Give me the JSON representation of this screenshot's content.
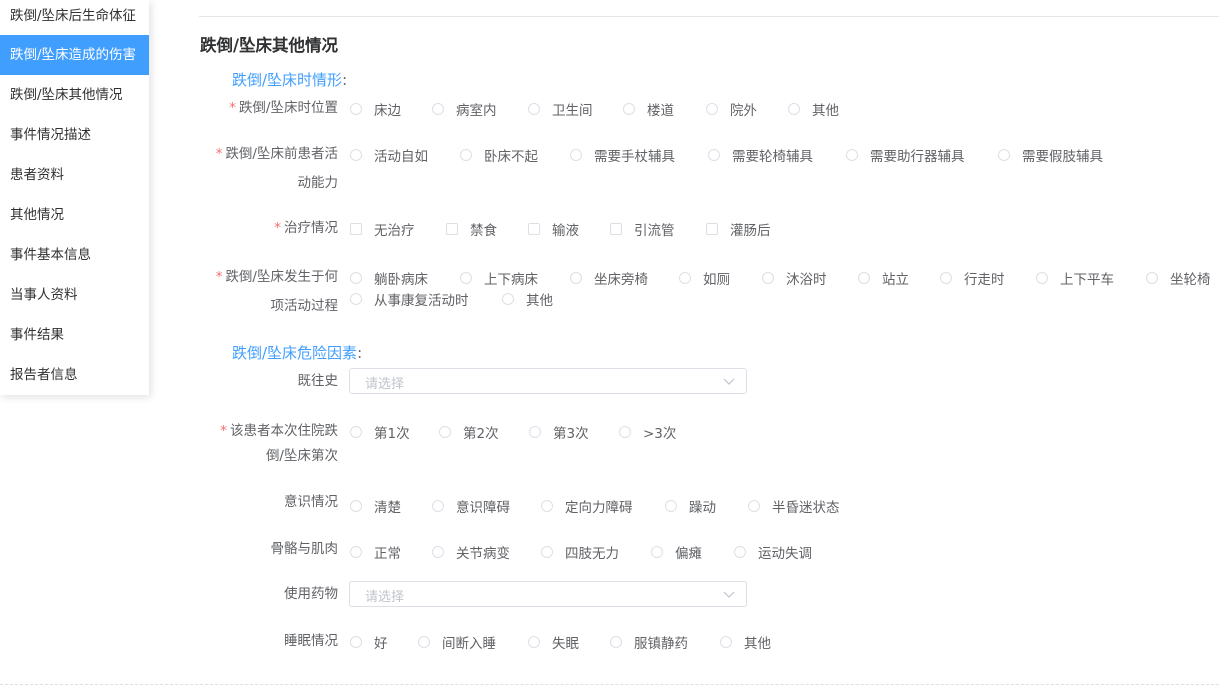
{
  "sidebar": {
    "items": [
      {
        "label": "跌倒/坠床后生命体征",
        "active": false
      },
      {
        "label": "跌倒/坠床造成的伤害",
        "active": true
      },
      {
        "label": "跌倒/坠床其他情况",
        "active": false
      },
      {
        "label": "事件情况描述",
        "active": false
      },
      {
        "label": "患者资料",
        "active": false
      },
      {
        "label": "其他情况",
        "active": false
      },
      {
        "label": "事件基本信息",
        "active": false
      },
      {
        "label": "当事人资料",
        "active": false
      },
      {
        "label": "事件结果",
        "active": false
      },
      {
        "label": "报告者信息",
        "active": false
      }
    ]
  },
  "main": {
    "section_title": "跌倒/坠床其他情况",
    "situation_title": "跌倒/坠床时情形",
    "risk_title": "跌倒/坠床危险因素",
    "colon": ":",
    "required_mark": "*",
    "fields": {
      "location": {
        "label": "跌倒/坠床时位置",
        "options": [
          "床边",
          "病室内",
          "卫生间",
          "楼道",
          "院外",
          "其他"
        ]
      },
      "ability": {
        "label_line1": "跌倒/坠床前患者活",
        "label_line2": "动能力",
        "options": [
          "活动自如",
          "卧床不起",
          "需要手杖辅具",
          "需要轮椅辅具",
          "需要助行器辅具",
          "需要假肢辅具"
        ]
      },
      "treatment": {
        "label": "治疗情况",
        "options": [
          "无治疗",
          "禁食",
          "输液",
          "引流管",
          "灌肠后"
        ]
      },
      "activity": {
        "label_line1": "跌倒/坠床发生于何",
        "label_line2": "项活动过程",
        "options": [
          "躺卧病床",
          "上下病床",
          "坐床旁椅",
          "如厕",
          "沐浴时",
          "站立",
          "行走时",
          "上下平车",
          "坐轮椅",
          "从事康复活动时",
          "其他"
        ]
      },
      "history": {
        "label": "既往史",
        "placeholder": "请选择"
      },
      "count": {
        "label_line1": "该患者本次住院跌",
        "label_line2": "倒/坠床第次",
        "options": [
          "第1次",
          "第2次",
          "第3次",
          ">3次"
        ]
      },
      "consciousness": {
        "label": "意识情况",
        "options": [
          "清楚",
          "意识障碍",
          "定向力障碍",
          "躁动",
          "半昏迷状态"
        ]
      },
      "musculoskeletal": {
        "label": "骨骼与肌肉",
        "options": [
          "正常",
          "关节病变",
          "四肢无力",
          "偏瘫",
          "运动失调"
        ]
      },
      "medication": {
        "label": "使用药物",
        "placeholder": "请选择"
      },
      "sleep": {
        "label": "睡眠情况",
        "options": [
          "好",
          "间断入睡",
          "失眠",
          "服镇静药",
          "其他"
        ]
      }
    }
  },
  "colors": {
    "accent": "#409eff",
    "required": "#f56c6c",
    "text": "#606266",
    "border": "#dcdfe6"
  },
  "icons": {
    "select_arrow": "chevron-down-icon"
  }
}
